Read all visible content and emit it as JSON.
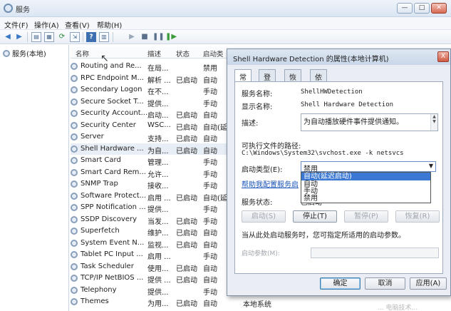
{
  "window": {
    "title": "服务"
  },
  "menu": [
    "文件(F)",
    "操作(A)",
    "查看(V)",
    "帮助(H)"
  ],
  "toolbar_icons": [
    "back-arrow-icon",
    "forward-arrow-icon",
    "console-tree-icon",
    "properties-icon",
    "refresh-icon",
    "export-icon",
    "help-icon",
    "show-action-pane-icon",
    "start-icon",
    "stop-icon",
    "pause-icon",
    "restart-icon"
  ],
  "tree": {
    "root_label": "服务(本地)"
  },
  "list": {
    "columns": [
      "名称",
      "描述",
      "状态",
      "启动类"
    ],
    "rows": [
      {
        "name": "Routing and Re...",
        "desc": "在局...",
        "status": "",
        "startup": "禁用"
      },
      {
        "name": "RPC Endpoint M...",
        "desc": "解析 ...",
        "status": "已启动",
        "startup": "自动"
      },
      {
        "name": "Secondary Logon",
        "desc": "在不...",
        "status": "",
        "startup": "手动"
      },
      {
        "name": "Secure Socket T...",
        "desc": "提供...",
        "status": "",
        "startup": "手动"
      },
      {
        "name": "Security Account...",
        "desc": "启动...",
        "status": "已启动",
        "startup": "自动"
      },
      {
        "name": "Security Center",
        "desc": "WSC...",
        "status": "已启动",
        "startup": "自动(延"
      },
      {
        "name": "Server",
        "desc": "支持...",
        "status": "已启动",
        "startup": "自动"
      },
      {
        "name": "Shell Hardware ...",
        "desc": "为自...",
        "status": "已启动",
        "startup": "自动"
      },
      {
        "name": "Smart Card",
        "desc": "管理...",
        "status": "",
        "startup": "手动"
      },
      {
        "name": "Smart Card Rem...",
        "desc": "允许...",
        "status": "",
        "startup": "手动"
      },
      {
        "name": "SNMP Trap",
        "desc": "接收...",
        "status": "",
        "startup": "手动"
      },
      {
        "name": "Software Protect...",
        "desc": "启用 ...",
        "status": "已启动",
        "startup": "自动(延"
      },
      {
        "name": "SPP Notification ...",
        "desc": "提供...",
        "status": "",
        "startup": "手动"
      },
      {
        "name": "SSDP Discovery",
        "desc": "当发...",
        "status": "已启动",
        "startup": "手动"
      },
      {
        "name": "Superfetch",
        "desc": "维护...",
        "status": "已启动",
        "startup": "自动"
      },
      {
        "name": "System Event N...",
        "desc": "监视...",
        "status": "已启动",
        "startup": "自动"
      },
      {
        "name": "Tablet PC Input ...",
        "desc": "启用 ...",
        "status": "",
        "startup": "手动"
      },
      {
        "name": "Task Scheduler",
        "desc": "使用...",
        "status": "已启动",
        "startup": "自动"
      },
      {
        "name": "TCP/IP NetBIOS ...",
        "desc": "提供 ...",
        "status": "已启动",
        "startup": "自动"
      },
      {
        "name": "Telephony",
        "desc": "提供...",
        "status": "",
        "startup": "手动"
      },
      {
        "name": "Themes",
        "desc": "为用...",
        "status": "已启动",
        "startup": "自动"
      }
    ],
    "logon_partial": "本地系统"
  },
  "dialog": {
    "title": "Shell Hardware Detection 的属性(本地计算机)",
    "close_label": "X",
    "tabs": [
      "常规",
      "登录",
      "恢复",
      "依存关系"
    ],
    "service_name_label": "服务名称:",
    "service_name": "ShellHWDetection",
    "display_name_label": "显示名称:",
    "display_name": "Shell Hardware Detection",
    "description_label": "描述:",
    "description": "为自动播放硬件事件提供通知。",
    "path_label": "可执行文件的路径:",
    "path": "C:\\Windows\\System32\\svchost.exe -k netsvcs",
    "startup_type_label": "启动类型(E):",
    "startup_type_value": "禁用",
    "startup_options": [
      "自动(延迟启动)",
      "自动",
      "手动",
      "禁用"
    ],
    "help_link": "帮助我配置服务启",
    "service_status_label": "服务状态:",
    "service_status": "已启动",
    "buttons": {
      "start": "启动(S)",
      "stop": "停止(T)",
      "pause": "暂停(P)",
      "resume": "恢复(R)"
    },
    "hint": "当从此处启动服务时，您可指定所适用的启动参数。",
    "start_params_label": "启动参数(M):",
    "ok": "确定",
    "cancel": "取消",
    "apply": "应用(A)"
  },
  "watermark": "...  电脑技术..."
}
